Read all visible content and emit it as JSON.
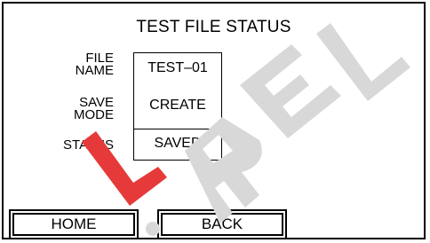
{
  "screen": {
    "title": "TEST FILE STATUS"
  },
  "fields": [
    {
      "label_line1": "FILE",
      "label_line2": "NAME",
      "value": "TEST–01"
    },
    {
      "label_line1": "SAVE",
      "label_line2": "MODE",
      "value": "CREATE"
    },
    {
      "label_line1": "STATUS",
      "label_line2": "",
      "value": "SAVED"
    }
  ],
  "buttons": {
    "home_label": "HOME",
    "back_label": "BACK"
  },
  "watermark": {
    "text": "L.REL",
    "color": "#e63a3a"
  }
}
